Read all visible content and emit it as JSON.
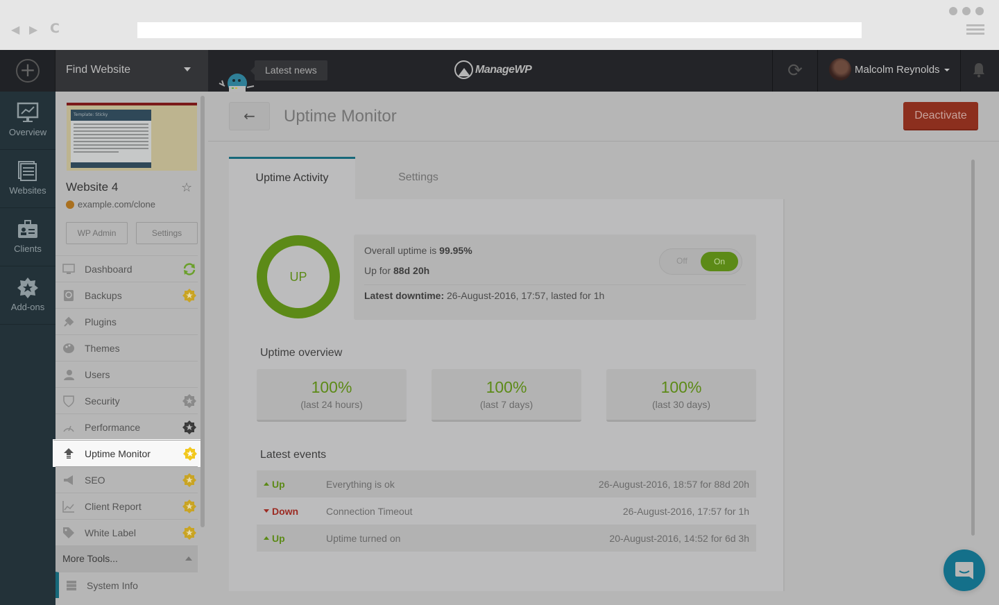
{
  "browser": {
    "url": ""
  },
  "topbar": {
    "find_website_label": "Find Website",
    "news_label": "Latest news",
    "brand": "ManageWP",
    "user_name": "Malcolm Reynolds"
  },
  "iconbar": {
    "items": [
      {
        "label": "Overview",
        "icon": "overview-icon"
      },
      {
        "label": "Websites",
        "icon": "websites-icon"
      },
      {
        "label": "Clients",
        "icon": "clients-icon"
      },
      {
        "label": "Add-ons",
        "icon": "addons-icon"
      }
    ]
  },
  "site": {
    "thumbnail_title": "Template: Sticky",
    "name": "Website 4",
    "url": "example.com/clone",
    "wp_admin_label": "WP Admin",
    "settings_label": "Settings"
  },
  "menu": {
    "items": [
      {
        "label": "Dashboard",
        "badge": "sync"
      },
      {
        "label": "Backups",
        "badge": "premium"
      },
      {
        "label": "Plugins",
        "badge": ""
      },
      {
        "label": "Themes",
        "badge": ""
      },
      {
        "label": "Users",
        "badge": ""
      },
      {
        "label": "Security",
        "badge": "premium-gray"
      },
      {
        "label": "Performance",
        "badge": "premium-dark"
      },
      {
        "label": "Uptime Monitor",
        "badge": "premium",
        "active": true
      },
      {
        "label": "SEO",
        "badge": "premium"
      },
      {
        "label": "Client Report",
        "badge": "premium"
      },
      {
        "label": "White Label",
        "badge": "premium"
      }
    ],
    "more_tools_label": "More Tools...",
    "sub_items": [
      {
        "label": "System Info"
      }
    ]
  },
  "main": {
    "title": "Uptime Monitor",
    "deactivate_label": "Deactivate",
    "tabs": [
      {
        "label": "Uptime Activity",
        "active": true
      },
      {
        "label": "Settings",
        "active": false
      }
    ],
    "status": {
      "ring_label": "UP",
      "overall_prefix": "Overall uptime is ",
      "overall_value": "99.95%",
      "up_for_prefix": "Up for ",
      "up_for_value": "88d 20h",
      "downtime_label": "Latest downtime:",
      "downtime_value": " 26-August-2016, 17:57, lasted for 1h",
      "toggle_off": "Off",
      "toggle_on": "On",
      "toggle_state": "on"
    },
    "overview_title": "Uptime overview",
    "overview": [
      {
        "value": "100%",
        "label": "(last 24 hours)"
      },
      {
        "value": "100%",
        "label": "(last 7 days)"
      },
      {
        "value": "100%",
        "label": "(last 30 days)"
      }
    ],
    "events_title": "Latest events",
    "events": [
      {
        "status": "Up",
        "message": "Everything is ok",
        "time": "26-August-2016, 18:57 for 88d 20h"
      },
      {
        "status": "Down",
        "message": "Connection Timeout",
        "time": "26-August-2016, 17:57 for 1h"
      },
      {
        "status": "Up",
        "message": "Uptime turned on",
        "time": "20-August-2016, 14:52 for 6d 3h"
      }
    ]
  },
  "colors": {
    "accent": "#17687a",
    "success": "#5c8a17",
    "danger": "#9c2b23",
    "deactivate": "#8c2f1e",
    "premium_badge": "#c9a424"
  }
}
